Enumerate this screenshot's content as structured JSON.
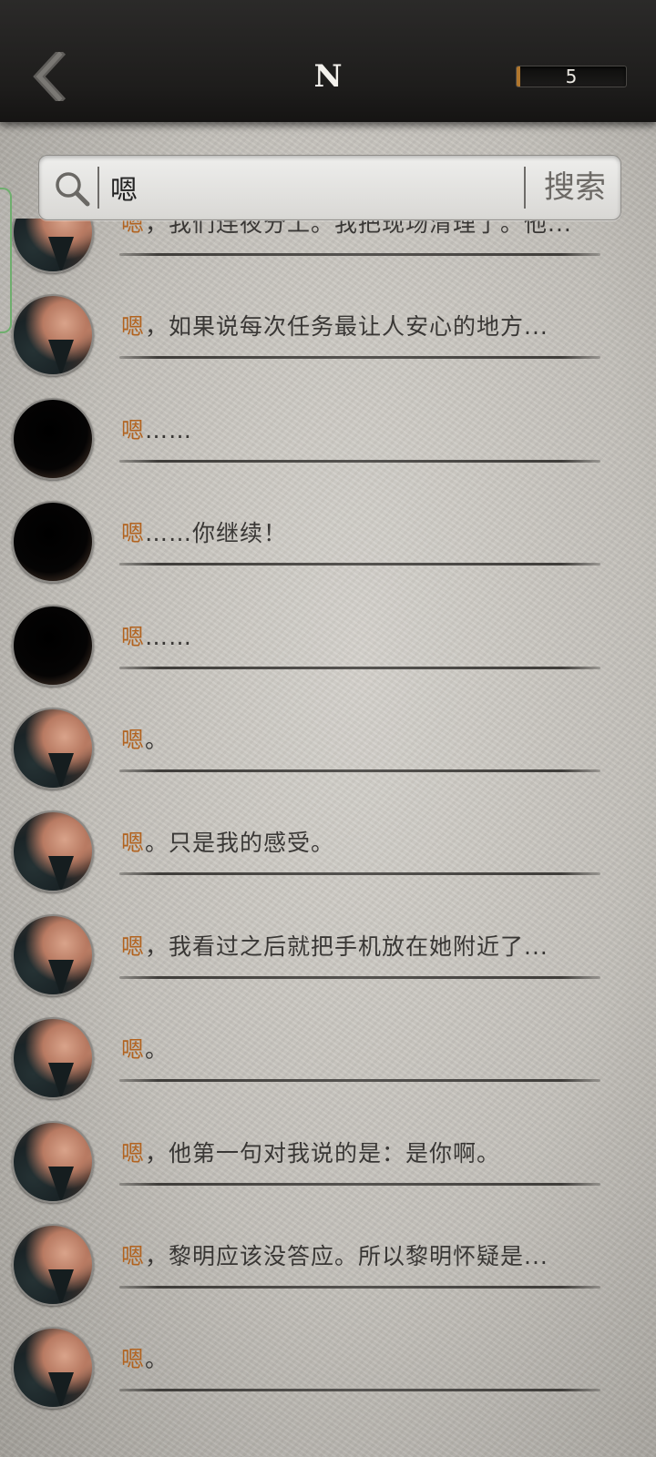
{
  "header": {
    "title": "N",
    "counter": "5",
    "back_icon": "chevron-left-icon"
  },
  "search": {
    "value": "嗯",
    "button_label": "搜索",
    "icon": "search-icon"
  },
  "colors": {
    "keyword": "#b2631f",
    "text": "#393735",
    "header": "#1e1d1c"
  },
  "results": [
    {
      "avatar": "face",
      "keyword": "嗯",
      "rest": "，我们连夜分工。我把现场清理了。他..."
    },
    {
      "avatar": "face",
      "keyword": "嗯",
      "rest": "，如果说每次任务最让人安心的地方..."
    },
    {
      "avatar": "dark",
      "keyword": "嗯",
      "rest": "……"
    },
    {
      "avatar": "dark",
      "keyword": "嗯",
      "rest": "……你继续！"
    },
    {
      "avatar": "dark",
      "keyword": "嗯",
      "rest": "……"
    },
    {
      "avatar": "face",
      "keyword": "嗯",
      "rest": "。"
    },
    {
      "avatar": "face",
      "keyword": "嗯",
      "rest": "。只是我的感受。"
    },
    {
      "avatar": "face",
      "keyword": "嗯",
      "rest": "，我看过之后就把手机放在她附近了..."
    },
    {
      "avatar": "face",
      "keyword": "嗯",
      "rest": "。"
    },
    {
      "avatar": "face",
      "keyword": "嗯",
      "rest": "，他第一句对我说的是：是你啊。"
    },
    {
      "avatar": "face",
      "keyword": "嗯",
      "rest": "，黎明应该没答应。所以黎明怀疑是..."
    },
    {
      "avatar": "face",
      "keyword": "嗯",
      "rest": "。"
    }
  ]
}
